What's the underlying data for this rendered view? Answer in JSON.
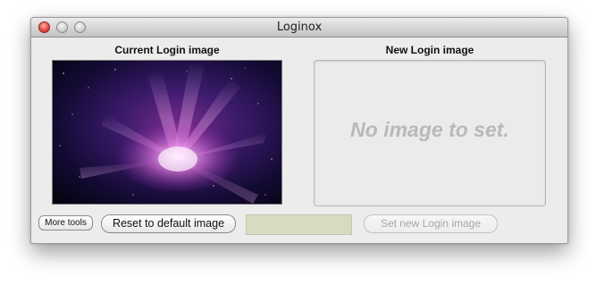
{
  "window": {
    "title": "Loginox",
    "controls": [
      "close-icon",
      "minimize-icon",
      "zoom-icon"
    ]
  },
  "current_panel": {
    "label": "Current Login image",
    "image": "galaxy-wallpaper"
  },
  "new_panel": {
    "label": "New Login image",
    "placeholder": "No image to set."
  },
  "buttons": {
    "more_tools": "More tools",
    "reset_default": "Reset to default image",
    "set_new": "Set new Login image"
  },
  "colors": {
    "window_bg": "#ececec",
    "field_box": "#d7dbc2",
    "placeholder_text": "#b9b9b9",
    "close_button": "#ea4a3f"
  }
}
